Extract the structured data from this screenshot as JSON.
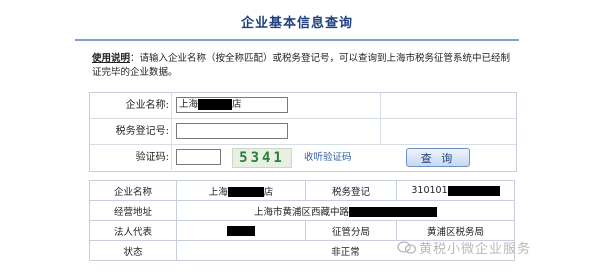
{
  "title": "企业基本信息查询",
  "notice": {
    "label": "使用说明",
    "text": "：请输入企业名称（按全称匹配）或税务登记号，可以查询到上海市税务征管系统中已经制证完毕的企业数据。"
  },
  "form": {
    "name_label": "企业名称:",
    "name_prefix": "上海",
    "name_suffix": "店",
    "taxid_label": "税务登记号:",
    "captcha_label": "验证码:",
    "captcha_code": "5341",
    "captcha_link": "收听验证码",
    "query_button": "查 询"
  },
  "result": {
    "headers": {
      "company_name": "企业名称",
      "tax_reg": "税务登记",
      "address": "经营地址",
      "legal_rep": "法人代表",
      "tax_bureau": "征管分局",
      "status": "状态"
    },
    "values": {
      "name_prefix": "上海",
      "name_suffix": "店",
      "tax_reg_prefix": "310101",
      "address_prefix": "上海市黄浦区西藏中路",
      "tax_bureau": "黄浦区税务局",
      "status": "非正常"
    }
  },
  "watermark": {
    "text": "黄税小微企业服务",
    "icon": "wechat-icon"
  }
}
